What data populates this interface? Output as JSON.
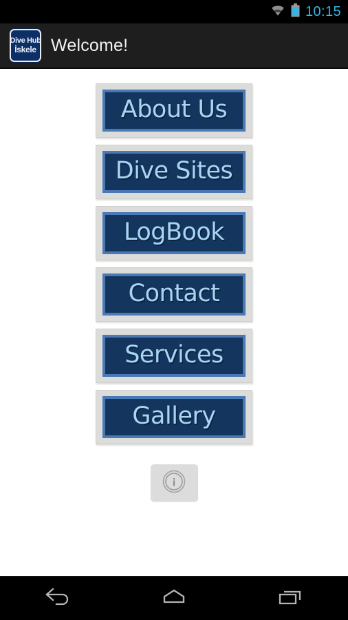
{
  "status_bar": {
    "clock": "10:15",
    "wifi_icon": "wifi-icon",
    "battery_icon": "battery-icon",
    "clock_color": "#33b5e5",
    "icon_color": "#9a9a9a",
    "background": "#000000"
  },
  "action_bar": {
    "title": "Welcome!",
    "background": "#1e1e1e",
    "title_color": "#f2f2f2",
    "app_icon": {
      "name": "dive-hub-iskele-app-icon",
      "line1": "Dive Hub",
      "line2": "İskele",
      "background": "#0c2f66",
      "text_color": "#eaf2fb"
    }
  },
  "content": {
    "background": "#ffffff",
    "menu_items": [
      {
        "label": "About Us",
        "name": "menu-button-about-us"
      },
      {
        "label": "Dive Sites",
        "name": "menu-button-dive-sites"
      },
      {
        "label": "LogBook",
        "name": "menu-button-logbook"
      },
      {
        "label": "Contact",
        "name": "menu-button-contact"
      },
      {
        "label": "Services",
        "name": "menu-button-services"
      },
      {
        "label": "Gallery",
        "name": "menu-button-gallery"
      }
    ],
    "button_style": {
      "outer_background": "#dcdcda",
      "frame_color": "#4a79b5",
      "inner_background": "#13355e",
      "label_color": "#a9d5f2"
    },
    "info_button": {
      "icon": "info-circle-icon",
      "label": "i",
      "background": "#dcdcdc",
      "icon_color": "#9b9b9b"
    }
  },
  "nav_bar": {
    "background": "#000000",
    "icon_color": "#b0b0b0",
    "keys": [
      {
        "name": "nav-back-icon",
        "label": "back"
      },
      {
        "name": "nav-home-icon",
        "label": "home"
      },
      {
        "name": "nav-recents-icon",
        "label": "recent apps"
      }
    ]
  }
}
